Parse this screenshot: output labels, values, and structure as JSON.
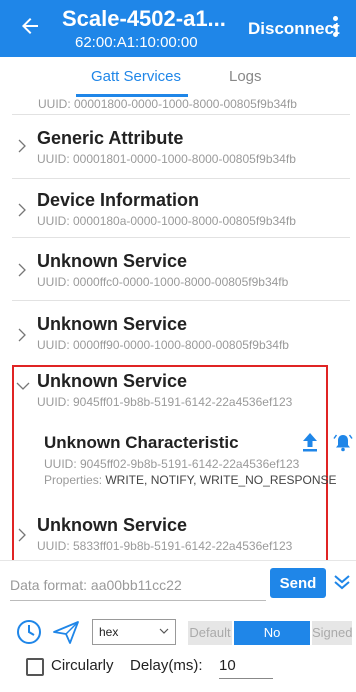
{
  "header": {
    "title": "Scale-4502-a1...",
    "subtitle": "62:00:A1:10:00:00",
    "disconnect_label": "Disconnect"
  },
  "tabs": [
    {
      "label": "Gatt Services",
      "active": true
    },
    {
      "label": "Logs",
      "active": false
    }
  ],
  "services": {
    "partial_uuid": "UUID: 00001800-0000-1000-8000-00805f9b34fb",
    "items": [
      {
        "name": "Generic Attribute",
        "uuid": "UUID: 00001801-0000-1000-8000-00805f9b34fb",
        "expanded": false
      },
      {
        "name": "Device Information",
        "uuid": "UUID: 0000180a-0000-1000-8000-00805f9b34fb",
        "expanded": false
      },
      {
        "name": "Unknown Service",
        "uuid": "UUID: 0000ffc0-0000-1000-8000-00805f9b34fb",
        "expanded": false
      },
      {
        "name": "Unknown Service",
        "uuid": "UUID: 0000ff90-0000-1000-8000-00805f9b34fb",
        "expanded": false
      },
      {
        "name": "Unknown Service",
        "uuid": "UUID: 9045ff01-9b8b-5191-6142-22a4536ef123",
        "expanded": true
      },
      {
        "name": "Unknown Service",
        "uuid": "UUID: 5833ff01-9b8b-5191-6142-22a4536ef123",
        "expanded": false
      }
    ]
  },
  "characteristic": {
    "name": "Unknown Characteristic",
    "uuid": "UUID: 9045ff02-9b8b-5191-6142-22a4536ef123",
    "properties_label": "Properties: ",
    "properties_value": "WRITE, NOTIFY, WRITE_NO_RESPONSE"
  },
  "controls": {
    "data_placeholder": "Data format: aa00bb11cc22",
    "send_label": "Send",
    "format_value": "hex",
    "write_types": [
      "Default",
      "No Response",
      "Signed"
    ],
    "selected_write_type": "No Response",
    "circularly_label": "Circularly",
    "delay_label": "Delay(ms):",
    "delay_value": "10"
  },
  "colors": {
    "primary": "#1f86e8",
    "highlight_border": "#e02424"
  },
  "icons": {
    "back": "arrow-left-icon",
    "menu": "more-vert-icon",
    "upload": "upload-icon",
    "notify": "bell-ring-icon",
    "expand_more": "double-chevron-down-icon",
    "history": "clock-icon",
    "send": "send-arrow-icon"
  }
}
